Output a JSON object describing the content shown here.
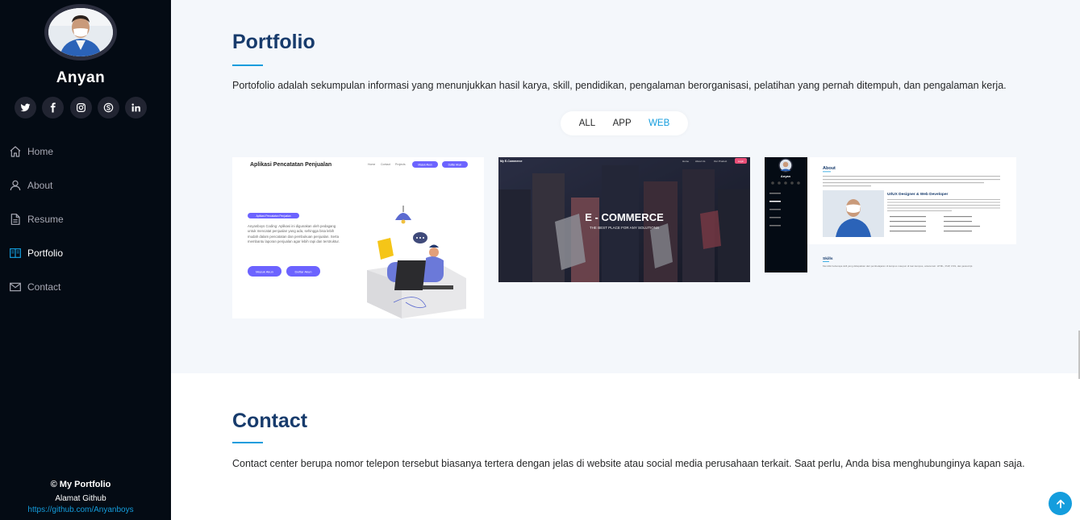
{
  "profile": {
    "name": "Anyan",
    "socials": [
      "twitter-icon",
      "facebook-icon",
      "instagram-icon",
      "skype-icon",
      "linkedin-icon"
    ]
  },
  "nav": {
    "items": [
      {
        "label": "Home",
        "icon": "home-icon"
      },
      {
        "label": "About",
        "icon": "user-icon"
      },
      {
        "label": "Resume",
        "icon": "file-icon"
      },
      {
        "label": "Portfolio",
        "icon": "book-icon",
        "active": true
      },
      {
        "label": "Contact",
        "icon": "envelope-icon"
      }
    ]
  },
  "footer": {
    "copyright": "© My Portfolio",
    "github_label": "Alamat Github",
    "github_link": "https://github.com/Anyanboys"
  },
  "portfolio": {
    "title": "Portfolio",
    "description": "Portofolio adalah sekumpulan informasi yang menunjukkan hasil karya, skill, pendidikan, pengalaman berorganisasi, pelatihan yang pernah ditempuh, dan pengalaman kerja.",
    "filters": [
      "ALL",
      "APP",
      "WEB"
    ],
    "active_filter": "WEB",
    "items": [
      {
        "name": "Aplikasi Pencatatan Penjualan",
        "nav": [
          "Home",
          "Contact",
          "Projects"
        ],
        "buttons": [
          "Masuk Akun",
          "Daftar Akun"
        ],
        "tag": "Aplikasi Pencatatan Penjualan",
        "body": "Anyanboys Coding: Aplikasi ini digunakan oleh pedagang untuk mencatat penjualan yang ada, sehingga bisa lebih mudah dalam pencatatan dan pembukuan penjualan. Serta membantu laporan penjualan agar lebih rapi dan terstruktur.",
        "cta": [
          "Masuk Akun",
          "Daftar Akun"
        ]
      },
      {
        "brand": "My E-Commerce",
        "nav": [
          "Home",
          "About Us",
          "Our Product"
        ],
        "login": "Login",
        "headline": "E - COMMERCE",
        "tagline": "THE BEST PLACE FOR ANY SOLUTIONS"
      },
      {
        "sidebar_name": "Anyan",
        "about_title": "About",
        "role": "UI/UX Designer & Web Developer",
        "skills_title": "Skills",
        "skills_text": "Memiliki beberapa skill yang didapatkan dari pembelajaran di kampus maupun di luar kampus, antara lain: HTML, PHP, CSS, dan javascript."
      }
    ]
  },
  "contact": {
    "title": "Contact",
    "description": "Contact center berupa nomor telepon tersebut biasanya tertera dengan jelas di website atau social media perusahaan terkait. Saat perlu, Anda bisa menghubunginya kapan saja."
  },
  "colors": {
    "sidebar_bg": "#040b14",
    "accent": "#149ddd",
    "heading": "#173b6c"
  }
}
